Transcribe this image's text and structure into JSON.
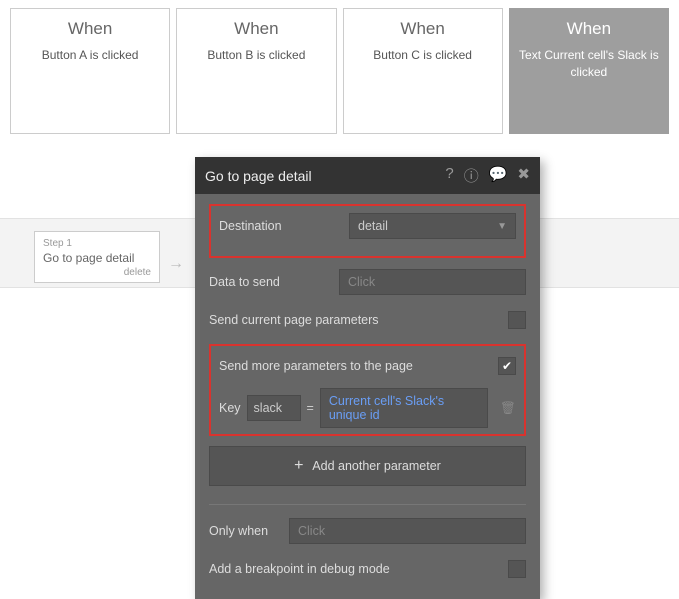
{
  "colors": {
    "highlight": "#d9332e",
    "link": "#6a9ef5"
  },
  "events": [
    {
      "when": "When",
      "desc": "Button A is clicked"
    },
    {
      "when": "When",
      "desc": "Button B is clicked"
    },
    {
      "when": "When",
      "desc": "Button C is clicked"
    },
    {
      "when": "When",
      "desc": "Text Current cell's Slack is clicked"
    }
  ],
  "step": {
    "label": "Step 1",
    "title": "Go to page detail",
    "delete": "delete"
  },
  "arrow": "→",
  "panel": {
    "title": "Go to page detail",
    "destination": {
      "label": "Destination",
      "value": "detail"
    },
    "data_to_send": {
      "label": "Data to send",
      "placeholder": "Click"
    },
    "send_current": {
      "label": "Send current page parameters",
      "checked": false
    },
    "send_more": {
      "label": "Send more parameters to the page",
      "checked": true
    },
    "param": {
      "key_label": "Key",
      "key": "slack",
      "eq": "=",
      "value": "Current cell's Slack's unique id"
    },
    "add_param": "Add another parameter",
    "only_when": {
      "label": "Only when",
      "placeholder": "Click"
    },
    "breakpoint": {
      "label": "Add a breakpoint in debug mode",
      "checked": false
    }
  }
}
